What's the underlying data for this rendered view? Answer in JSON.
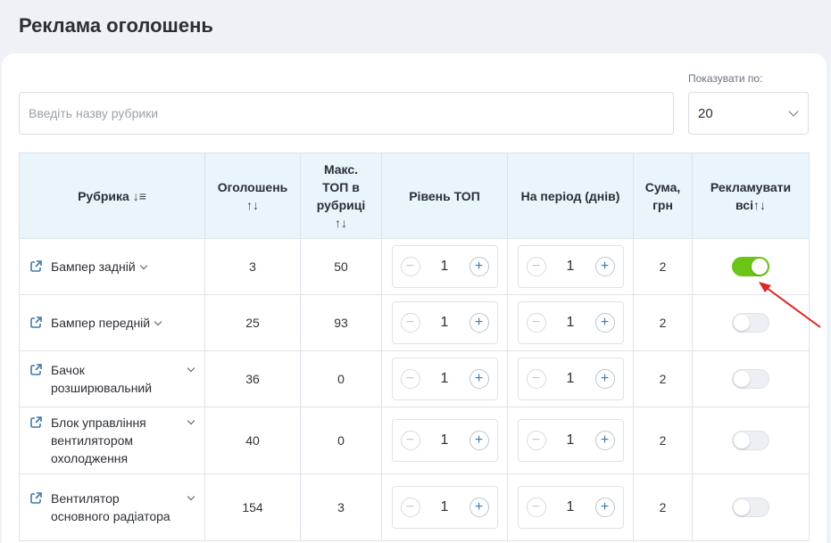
{
  "page": {
    "title": "Реклама оголошень"
  },
  "search": {
    "placeholder": "Введіть назву рубрики",
    "value": ""
  },
  "per_page": {
    "label": "Показувати по:",
    "value": "20"
  },
  "table": {
    "headers": {
      "rubric": "Рубрика",
      "ads": "Оголошень",
      "max_top": "Макс. ТОП в рубриці",
      "level": "Рівень ТОП",
      "period": "На період (днів)",
      "sum": "Сума, грн",
      "advertise_all": "Рекламувати всі"
    },
    "sort_glyphs": {
      "rubric": "↓≡",
      "ads": "↑↓",
      "max_top": "↑↓",
      "advertise_all": "↑↓"
    },
    "rows": [
      {
        "rubric": "Бампер задній",
        "ads": "3",
        "max_top": "50",
        "level": "1",
        "period": "1",
        "sum": "2",
        "enabled": true
      },
      {
        "rubric": "Бампер передній",
        "ads": "25",
        "max_top": "93",
        "level": "1",
        "period": "1",
        "sum": "2",
        "enabled": false
      },
      {
        "rubric": "Бачок розширювальний",
        "ads": "36",
        "max_top": "0",
        "level": "1",
        "period": "1",
        "sum": "2",
        "enabled": false
      },
      {
        "rubric": "Блок управління вентилятором охолодження",
        "ads": "40",
        "max_top": "0",
        "level": "1",
        "period": "1",
        "sum": "2",
        "enabled": false
      },
      {
        "rubric": "Вентилятор основного радіатора",
        "ads": "154",
        "max_top": "3",
        "level": "1",
        "period": "1",
        "sum": "2",
        "enabled": false
      }
    ]
  },
  "stepper_glyphs": {
    "minus": "−",
    "plus": "+"
  },
  "colors": {
    "accent_blue": "#3f79a9",
    "toggle_on": "#6cc417",
    "annotation_arrow": "#e02424",
    "header_bg": "#eaf4fb"
  },
  "icons": {
    "row_link": "external-link-icon",
    "expand": "chevron-down-icon",
    "annotation": "red-arrow-icon"
  }
}
